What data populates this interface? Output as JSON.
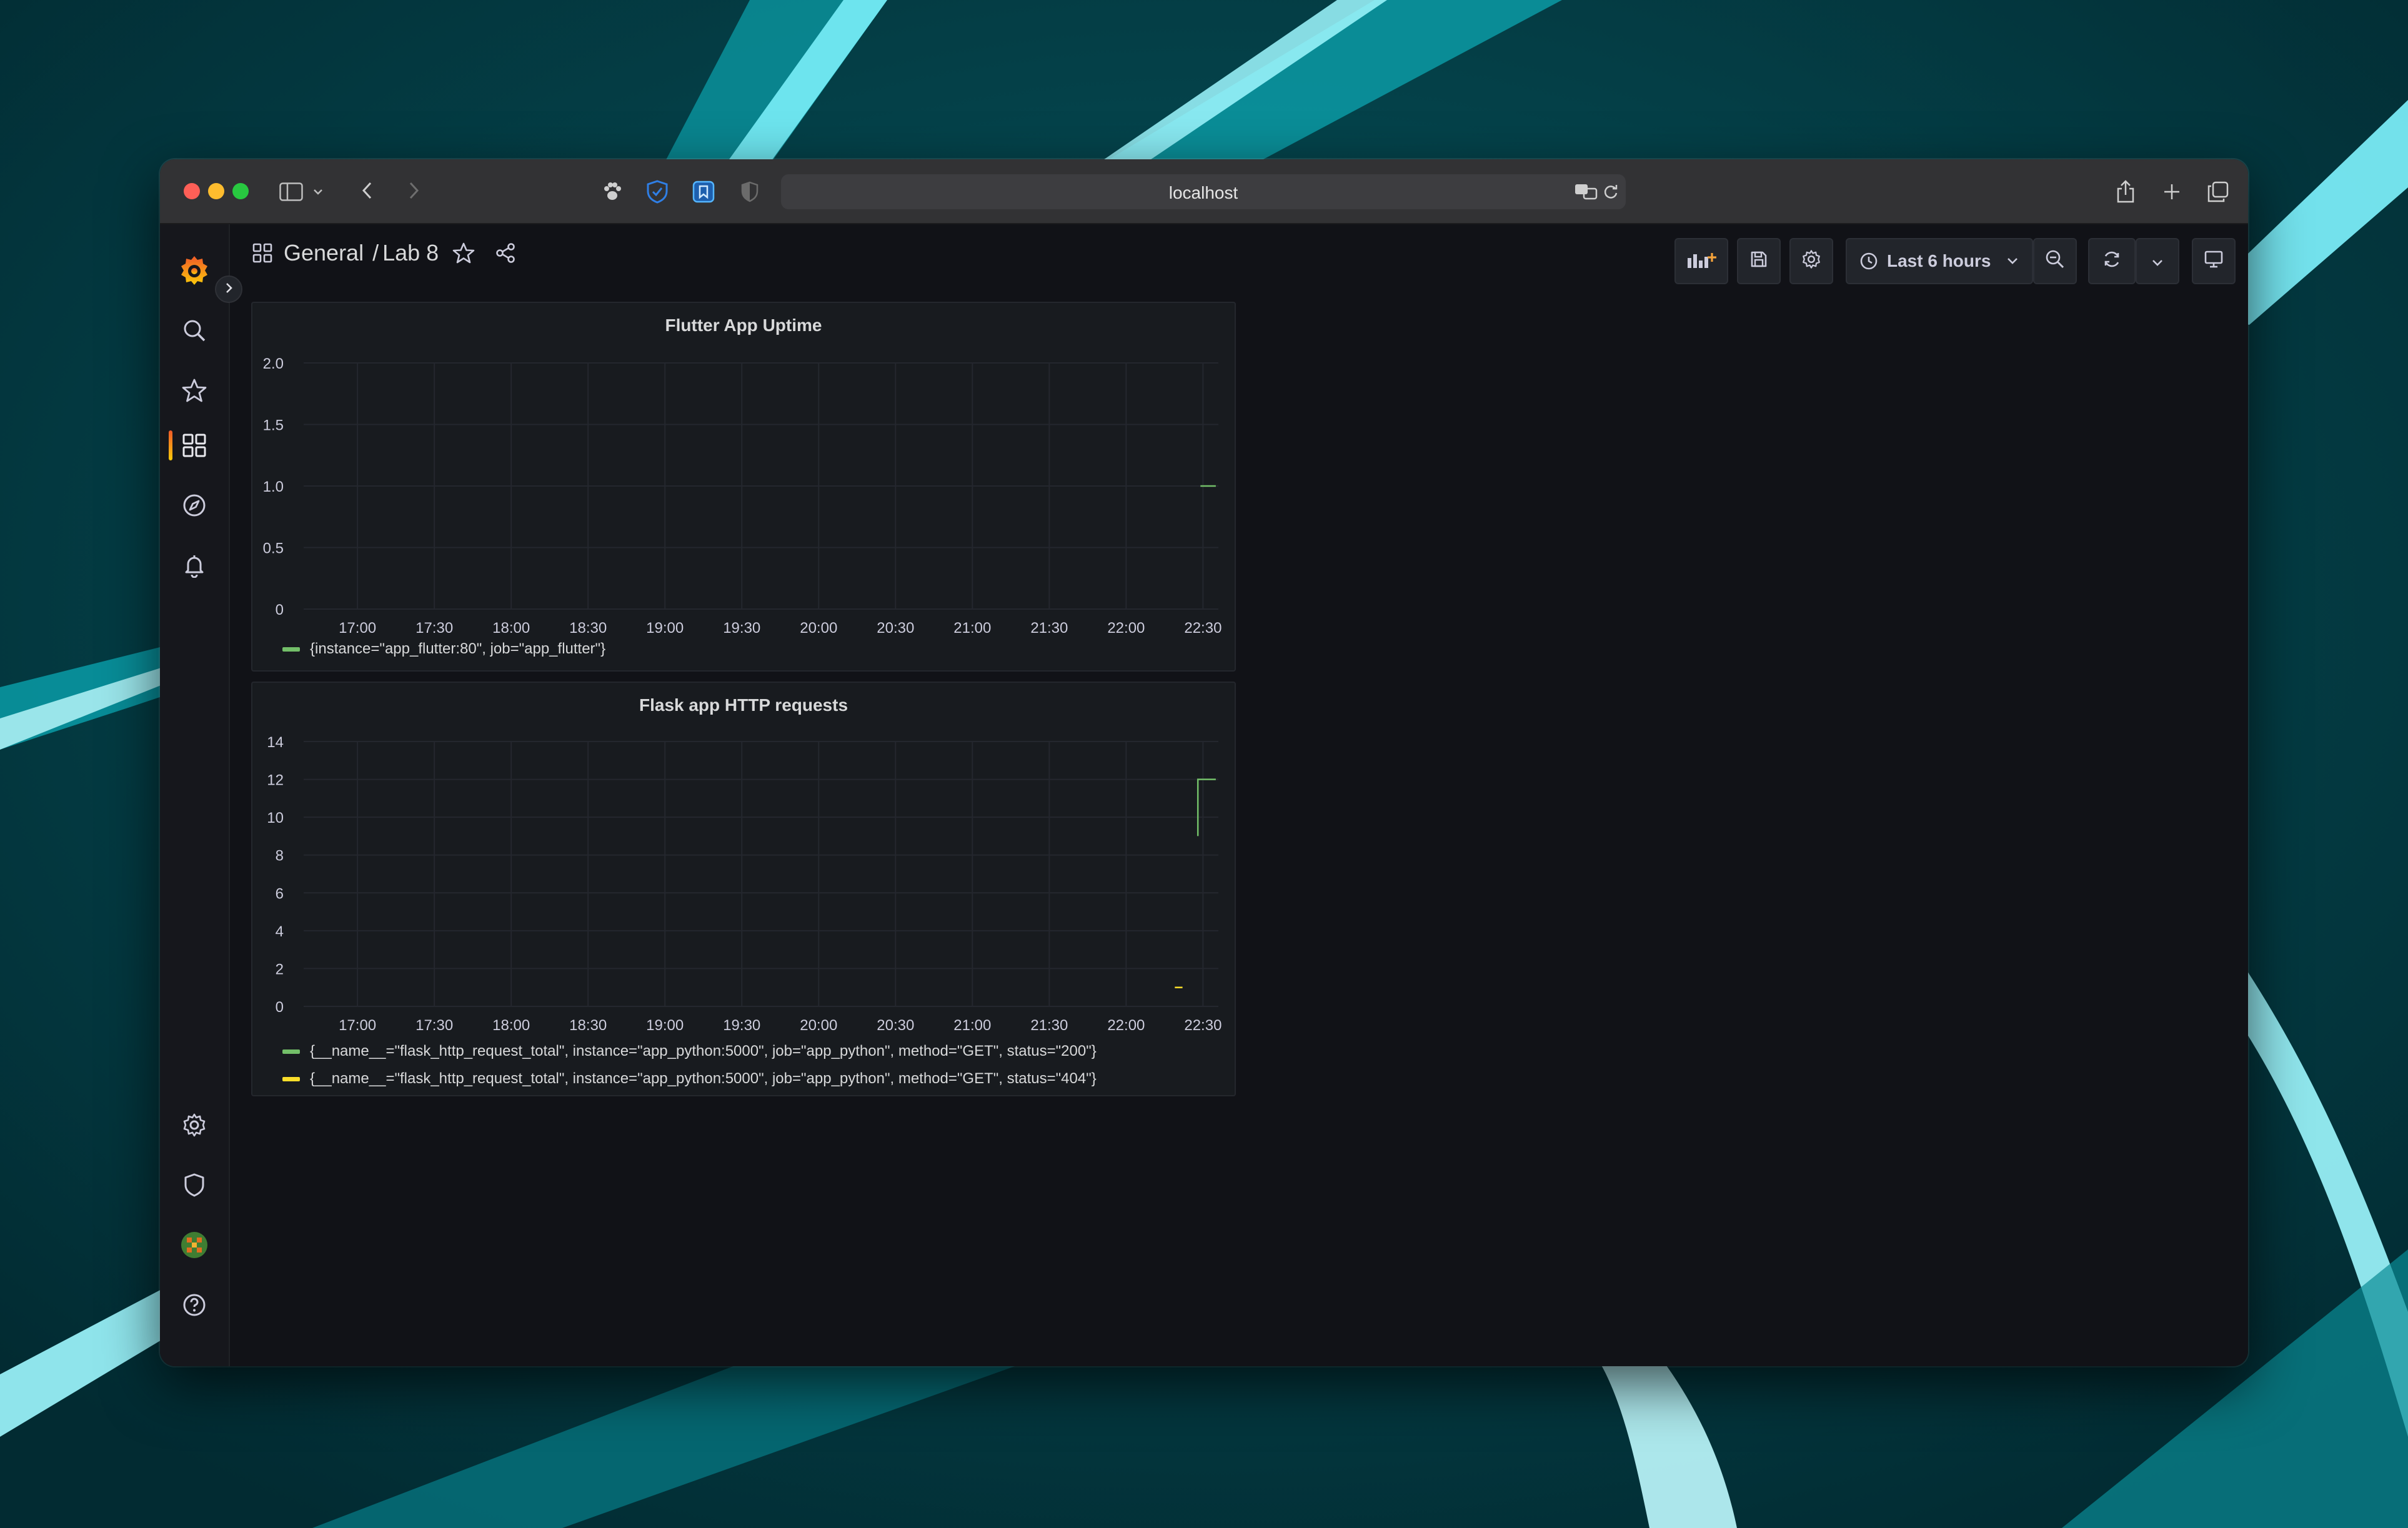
{
  "browser": {
    "url": "localhost",
    "traffic_lights": {
      "close": "#fe5f57",
      "minimize": "#febc2e",
      "zoom": "#28c840"
    }
  },
  "icons": {
    "sidebar_toggle": "sidebar-icon",
    "back": "chevron-left-icon",
    "forward": "chevron-right-icon",
    "extensions": [
      "paw-icon",
      "shield-check-icon",
      "bookmark-icon",
      "half-shield-icon"
    ],
    "translate": "translate-icon",
    "reload": "reload-icon",
    "share": "share-icon",
    "new_tab": "plus-icon",
    "tabs": "tabs-overview-icon"
  },
  "sidemenu": {
    "logo": "grafana-logo",
    "items": [
      {
        "name": "search",
        "icon": "search-icon"
      },
      {
        "name": "starred",
        "icon": "star-icon"
      },
      {
        "name": "dashboards",
        "icon": "apps-icon",
        "active": true
      },
      {
        "name": "explore",
        "icon": "compass-icon"
      },
      {
        "name": "alerting",
        "icon": "bell-icon"
      }
    ],
    "bottom_items": [
      {
        "name": "configuration",
        "icon": "gear-icon"
      },
      {
        "name": "server-admin",
        "icon": "shield-icon"
      },
      {
        "name": "profile",
        "icon": "avatar"
      },
      {
        "name": "help",
        "icon": "question-circle-icon"
      }
    ]
  },
  "navbar": {
    "folder": "General",
    "separator": "/",
    "dashboard": "Lab 8",
    "time_range": "Last 6 hours"
  },
  "colors": {
    "accent": "#f05a28",
    "series_green": "#73bf69",
    "series_yellow": "#fade2a",
    "panel_bg": "#181b1f",
    "page_bg": "#111217"
  },
  "panels": [
    {
      "title": "Flutter App Uptime",
      "chart_data": {
        "type": "line",
        "x_ticks": [
          "17:00",
          "17:30",
          "18:00",
          "18:30",
          "19:00",
          "19:30",
          "20:00",
          "20:30",
          "21:00",
          "21:30",
          "22:00",
          "22:30"
        ],
        "y_ticks": [
          "0",
          "0.5",
          "1.0",
          "1.5",
          "2.0"
        ],
        "ylim": [
          0,
          2
        ],
        "xlim": [
          "16:39",
          "22:36"
        ],
        "grid": true,
        "legend_placement": "bottom",
        "series": [
          {
            "name": "{instance=\"app_flutter:80\", job=\"app_flutter\"}",
            "color": "#73bf69",
            "points": [
              [
                "22:29",
                1
              ],
              [
                "22:35",
                1
              ]
            ]
          }
        ]
      }
    },
    {
      "title": "Flask app HTTP requests",
      "chart_data": {
        "type": "line",
        "x_ticks": [
          "17:00",
          "17:30",
          "18:00",
          "18:30",
          "19:00",
          "19:30",
          "20:00",
          "20:30",
          "21:00",
          "21:30",
          "22:00",
          "22:30"
        ],
        "y_ticks": [
          "0",
          "2",
          "4",
          "6",
          "8",
          "10",
          "12",
          "14"
        ],
        "ylim": [
          0,
          14
        ],
        "xlim": [
          "16:39",
          "22:36"
        ],
        "grid": true,
        "legend_placement": "bottom",
        "series": [
          {
            "name": "{__name__=\"flask_http_request_total\", instance=\"app_python:5000\", job=\"app_python\", method=\"GET\", status=\"200\"}",
            "color": "#73bf69",
            "points": [
              [
                "22:28",
                9
              ],
              [
                "22:28",
                12
              ],
              [
                "22:35",
                12
              ]
            ]
          },
          {
            "name": "{__name__=\"flask_http_request_total\", instance=\"app_python:5000\", job=\"app_python\", method=\"GET\", status=\"404\"}",
            "color": "#fade2a",
            "points": [
              [
                "22:19",
                1
              ],
              [
                "22:22",
                1
              ]
            ]
          }
        ]
      }
    }
  ]
}
